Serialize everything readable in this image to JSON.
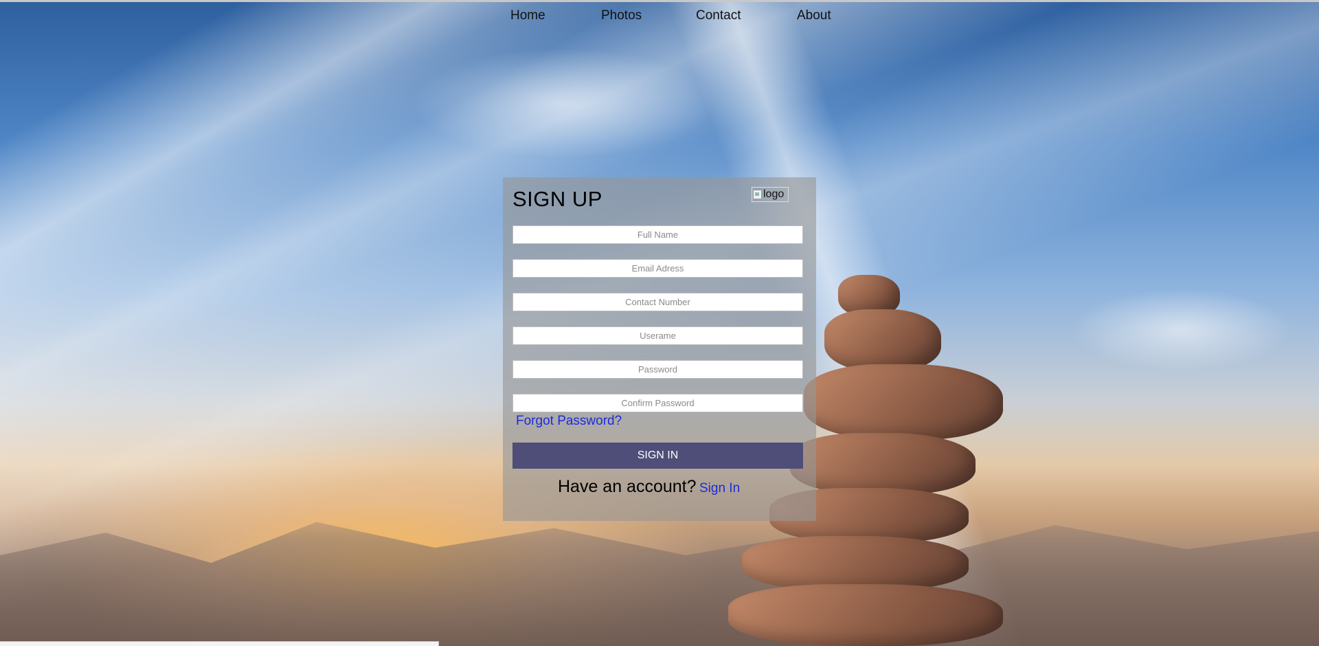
{
  "nav": {
    "items": [
      {
        "label": "Home"
      },
      {
        "label": "Photos"
      },
      {
        "label": "Contact"
      },
      {
        "label": "About"
      }
    ]
  },
  "form": {
    "title": "SIGN UP",
    "logo_alt": "logo",
    "fields": [
      {
        "placeholder": "Full Name",
        "value": ""
      },
      {
        "placeholder": "Email Adress",
        "value": ""
      },
      {
        "placeholder": "Contact Number",
        "value": ""
      },
      {
        "placeholder": "Userame",
        "value": ""
      },
      {
        "placeholder": "Password",
        "value": ""
      },
      {
        "placeholder": "Confirm Password",
        "value": ""
      }
    ],
    "forgot_label": "Forgot Password?",
    "submit_label": "SIGN IN",
    "have_account_text": "Have an account?",
    "signin_link_label": "Sign In"
  },
  "colors": {
    "button_bg": "#4f4e78",
    "link": "#1d2bd8",
    "card_bg": "rgba(150,150,150,0.62)"
  }
}
